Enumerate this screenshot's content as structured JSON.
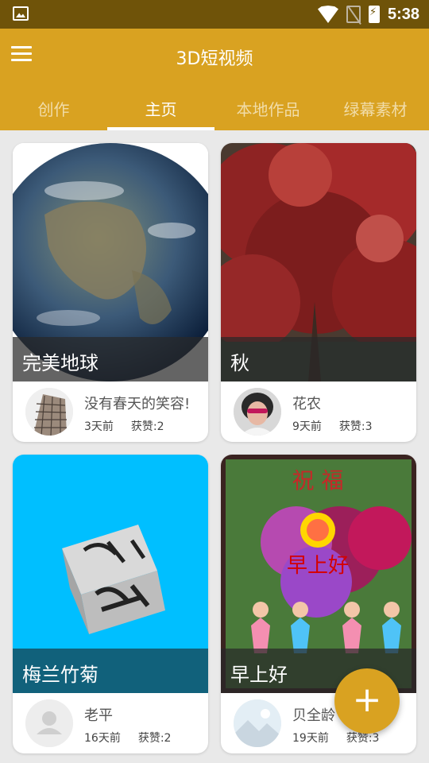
{
  "status_bar": {
    "time": "5:38"
  },
  "app": {
    "title": "3D短视频"
  },
  "tabs": [
    {
      "label": "创作"
    },
    {
      "label": "主页"
    },
    {
      "label": "本地作品"
    },
    {
      "label": "绿幕素材"
    }
  ],
  "active_tab": "主页",
  "cards": [
    {
      "caption": "完美地球",
      "author": "没有春天的笑容!",
      "time_ago": "3天前",
      "likes": "获赞:2"
    },
    {
      "caption": "秋",
      "author": "花农",
      "time_ago": "9天前",
      "likes": "获赞:3"
    },
    {
      "caption": "梅兰竹菊",
      "author": "老平",
      "time_ago": "16天前",
      "likes": "获赞:2"
    },
    {
      "caption": "早上好",
      "author": "贝全龄",
      "time_ago": "19天前",
      "likes": "获赞:3"
    }
  ],
  "thumb_texts": {
    "greeting_top": "祝 福",
    "greeting_main": "早上好"
  },
  "fab": {
    "label": "+"
  },
  "colors": {
    "primary": "#d9a221",
    "status_bar": "#6f5309"
  }
}
